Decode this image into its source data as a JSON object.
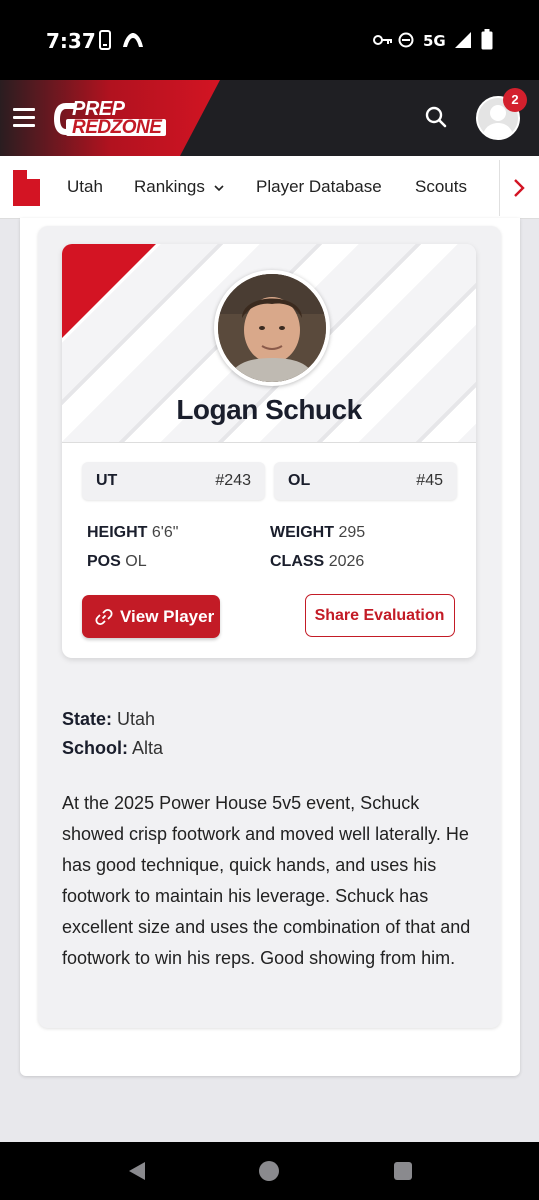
{
  "status_bar": {
    "time": "7:37",
    "network": "5G"
  },
  "header": {
    "logo_line1": "PREP",
    "logo_line2": "REDZONE",
    "notification_count": "2"
  },
  "nav": {
    "items": [
      "Utah",
      "Rankings",
      "Player Database",
      "Scouts"
    ]
  },
  "player": {
    "name": "Logan Schuck",
    "state_abbr": "UT",
    "state_rank": "#243",
    "position_abbr": "OL",
    "position_rank": "#45",
    "height_label": "HEIGHT",
    "height": "6'6\"",
    "weight_label": "WEIGHT",
    "weight": "295",
    "pos_label": "POS",
    "pos": "OL",
    "class_label": "CLASS",
    "class": "2026",
    "view_button": "View Player",
    "share_button": "Share Evaluation"
  },
  "details": {
    "state_label": "State:",
    "state": "Utah",
    "school_label": "School:",
    "school": "Alta"
  },
  "evaluation": "At the 2025 Power House 5v5 event, Schuck showed crisp footwork and moved well laterally. He has good technique, quick hands, and uses his footwork to maintain his leverage. Schuck has excellent size and uses the combination of that and footwork to win his reps. Good showing from him.",
  "colors": {
    "brand_red": "#d31423",
    "header_bg": "#1f1f23"
  }
}
